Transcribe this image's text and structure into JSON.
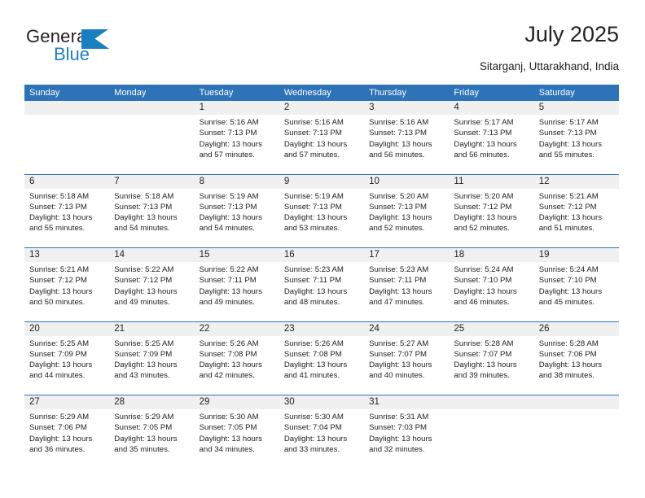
{
  "logo": {
    "word_dark": "General",
    "word_blue": "Blue",
    "triangle_color": "#1a7fc1",
    "icon": "general-blue-logo"
  },
  "header": {
    "month_title": "July 2025",
    "location": "Sitarganj, Uttarakhand, India"
  },
  "colors": {
    "header_blue": "#2e73b8",
    "row_divider": "#2e73b8",
    "day_number_band": "#f0f0f0",
    "text": "#222222",
    "logo_blue": "#1a7fc1"
  },
  "calendar": {
    "weekdays": [
      "Sunday",
      "Monday",
      "Tuesday",
      "Wednesday",
      "Thursday",
      "Friday",
      "Saturday"
    ],
    "weeks": [
      [
        {
          "day": "",
          "empty": true
        },
        {
          "day": "",
          "empty": true
        },
        {
          "day": "1",
          "sunrise": "Sunrise: 5:16 AM",
          "sunset": "Sunset: 7:13 PM",
          "daylight": "Daylight: 13 hours and 57 minutes."
        },
        {
          "day": "2",
          "sunrise": "Sunrise: 5:16 AM",
          "sunset": "Sunset: 7:13 PM",
          "daylight": "Daylight: 13 hours and 57 minutes."
        },
        {
          "day": "3",
          "sunrise": "Sunrise: 5:16 AM",
          "sunset": "Sunset: 7:13 PM",
          "daylight": "Daylight: 13 hours and 56 minutes."
        },
        {
          "day": "4",
          "sunrise": "Sunrise: 5:17 AM",
          "sunset": "Sunset: 7:13 PM",
          "daylight": "Daylight: 13 hours and 56 minutes."
        },
        {
          "day": "5",
          "sunrise": "Sunrise: 5:17 AM",
          "sunset": "Sunset: 7:13 PM",
          "daylight": "Daylight: 13 hours and 55 minutes."
        }
      ],
      [
        {
          "day": "6",
          "sunrise": "Sunrise: 5:18 AM",
          "sunset": "Sunset: 7:13 PM",
          "daylight": "Daylight: 13 hours and 55 minutes."
        },
        {
          "day": "7",
          "sunrise": "Sunrise: 5:18 AM",
          "sunset": "Sunset: 7:13 PM",
          "daylight": "Daylight: 13 hours and 54 minutes."
        },
        {
          "day": "8",
          "sunrise": "Sunrise: 5:19 AM",
          "sunset": "Sunset: 7:13 PM",
          "daylight": "Daylight: 13 hours and 54 minutes."
        },
        {
          "day": "9",
          "sunrise": "Sunrise: 5:19 AM",
          "sunset": "Sunset: 7:13 PM",
          "daylight": "Daylight: 13 hours and 53 minutes."
        },
        {
          "day": "10",
          "sunrise": "Sunrise: 5:20 AM",
          "sunset": "Sunset: 7:13 PM",
          "daylight": "Daylight: 13 hours and 52 minutes."
        },
        {
          "day": "11",
          "sunrise": "Sunrise: 5:20 AM",
          "sunset": "Sunset: 7:12 PM",
          "daylight": "Daylight: 13 hours and 52 minutes."
        },
        {
          "day": "12",
          "sunrise": "Sunrise: 5:21 AM",
          "sunset": "Sunset: 7:12 PM",
          "daylight": "Daylight: 13 hours and 51 minutes."
        }
      ],
      [
        {
          "day": "13",
          "sunrise": "Sunrise: 5:21 AM",
          "sunset": "Sunset: 7:12 PM",
          "daylight": "Daylight: 13 hours and 50 minutes."
        },
        {
          "day": "14",
          "sunrise": "Sunrise: 5:22 AM",
          "sunset": "Sunset: 7:12 PM",
          "daylight": "Daylight: 13 hours and 49 minutes."
        },
        {
          "day": "15",
          "sunrise": "Sunrise: 5:22 AM",
          "sunset": "Sunset: 7:11 PM",
          "daylight": "Daylight: 13 hours and 49 minutes."
        },
        {
          "day": "16",
          "sunrise": "Sunrise: 5:23 AM",
          "sunset": "Sunset: 7:11 PM",
          "daylight": "Daylight: 13 hours and 48 minutes."
        },
        {
          "day": "17",
          "sunrise": "Sunrise: 5:23 AM",
          "sunset": "Sunset: 7:11 PM",
          "daylight": "Daylight: 13 hours and 47 minutes."
        },
        {
          "day": "18",
          "sunrise": "Sunrise: 5:24 AM",
          "sunset": "Sunset: 7:10 PM",
          "daylight": "Daylight: 13 hours and 46 minutes."
        },
        {
          "day": "19",
          "sunrise": "Sunrise: 5:24 AM",
          "sunset": "Sunset: 7:10 PM",
          "daylight": "Daylight: 13 hours and 45 minutes."
        }
      ],
      [
        {
          "day": "20",
          "sunrise": "Sunrise: 5:25 AM",
          "sunset": "Sunset: 7:09 PM",
          "daylight": "Daylight: 13 hours and 44 minutes."
        },
        {
          "day": "21",
          "sunrise": "Sunrise: 5:25 AM",
          "sunset": "Sunset: 7:09 PM",
          "daylight": "Daylight: 13 hours and 43 minutes."
        },
        {
          "day": "22",
          "sunrise": "Sunrise: 5:26 AM",
          "sunset": "Sunset: 7:08 PM",
          "daylight": "Daylight: 13 hours and 42 minutes."
        },
        {
          "day": "23",
          "sunrise": "Sunrise: 5:26 AM",
          "sunset": "Sunset: 7:08 PM",
          "daylight": "Daylight: 13 hours and 41 minutes."
        },
        {
          "day": "24",
          "sunrise": "Sunrise: 5:27 AM",
          "sunset": "Sunset: 7:07 PM",
          "daylight": "Daylight: 13 hours and 40 minutes."
        },
        {
          "day": "25",
          "sunrise": "Sunrise: 5:28 AM",
          "sunset": "Sunset: 7:07 PM",
          "daylight": "Daylight: 13 hours and 39 minutes."
        },
        {
          "day": "26",
          "sunrise": "Sunrise: 5:28 AM",
          "sunset": "Sunset: 7:06 PM",
          "daylight": "Daylight: 13 hours and 38 minutes."
        }
      ],
      [
        {
          "day": "27",
          "sunrise": "Sunrise: 5:29 AM",
          "sunset": "Sunset: 7:06 PM",
          "daylight": "Daylight: 13 hours and 36 minutes."
        },
        {
          "day": "28",
          "sunrise": "Sunrise: 5:29 AM",
          "sunset": "Sunset: 7:05 PM",
          "daylight": "Daylight: 13 hours and 35 minutes."
        },
        {
          "day": "29",
          "sunrise": "Sunrise: 5:30 AM",
          "sunset": "Sunset: 7:05 PM",
          "daylight": "Daylight: 13 hours and 34 minutes."
        },
        {
          "day": "30",
          "sunrise": "Sunrise: 5:30 AM",
          "sunset": "Sunset: 7:04 PM",
          "daylight": "Daylight: 13 hours and 33 minutes."
        },
        {
          "day": "31",
          "sunrise": "Sunrise: 5:31 AM",
          "sunset": "Sunset: 7:03 PM",
          "daylight": "Daylight: 13 hours and 32 minutes."
        },
        {
          "day": "",
          "empty": true
        },
        {
          "day": "",
          "empty": true
        }
      ]
    ]
  }
}
